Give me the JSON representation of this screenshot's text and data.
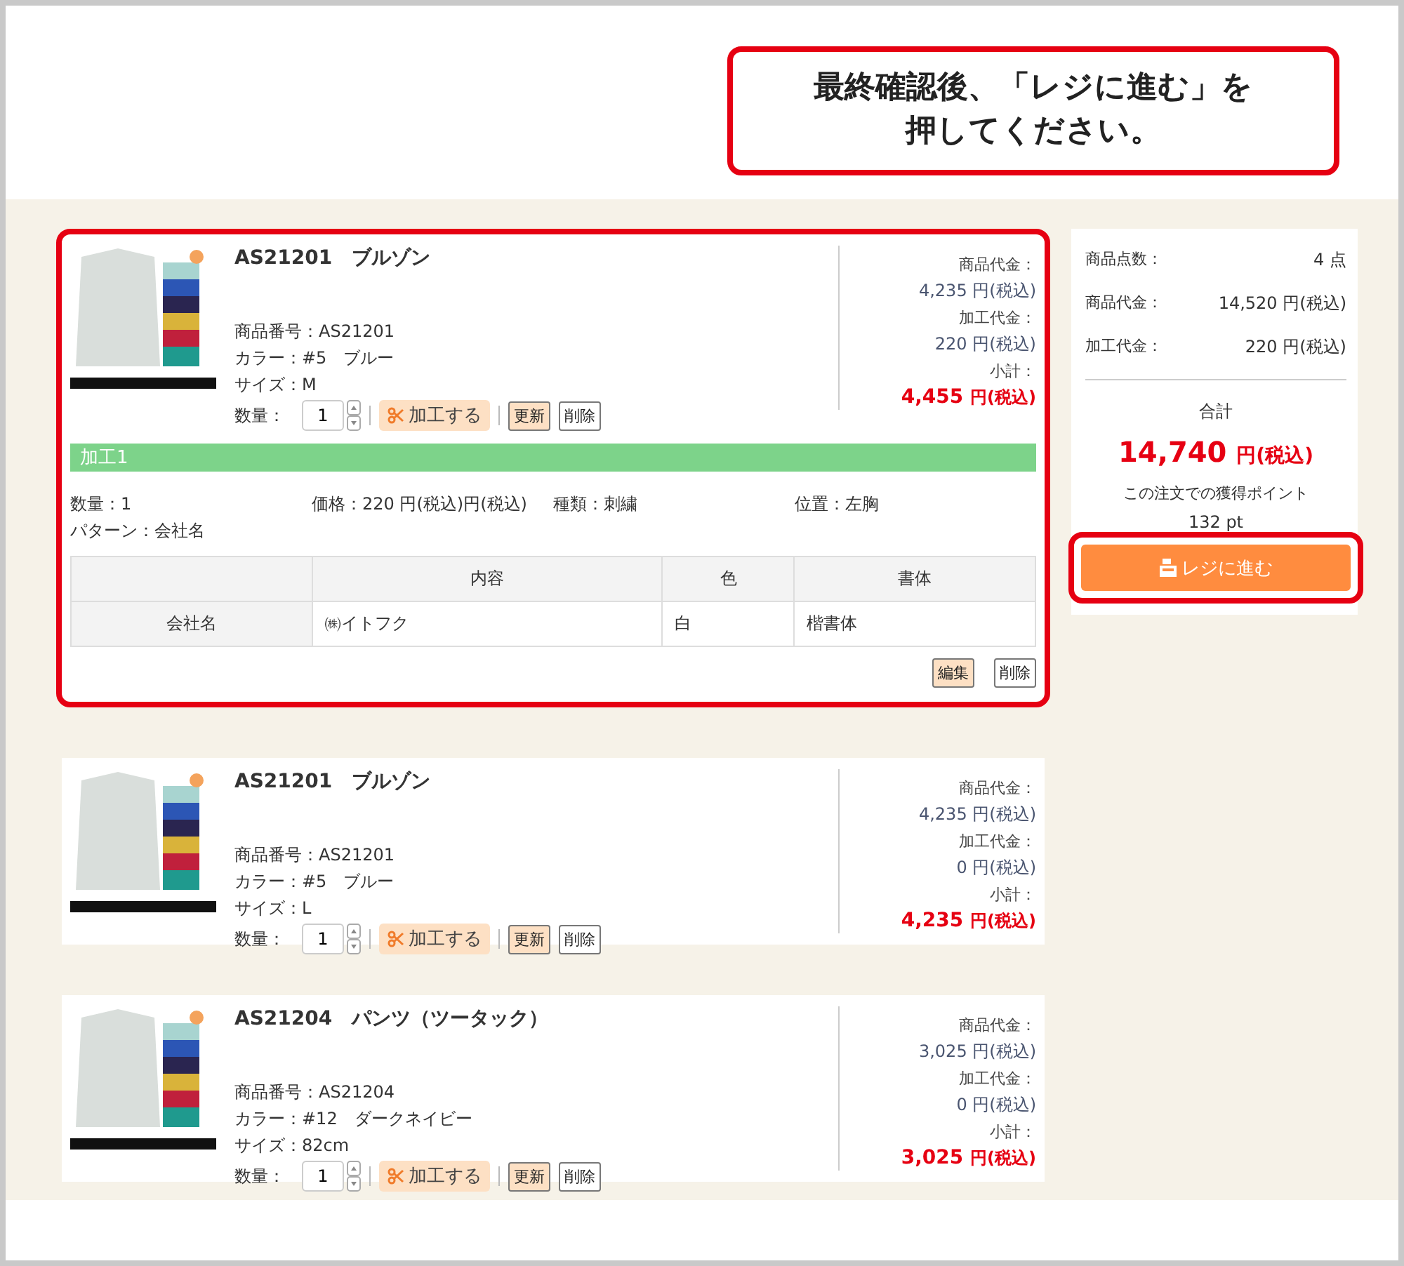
{
  "callout": {
    "text": "最終確認後、「レジに進む」を押してください。"
  },
  "items": [
    {
      "highlighted": true,
      "title": "AS21201　ブルゾン",
      "code": "商品番号：AS21201",
      "color_line": "カラー：#5　ブルー",
      "size": "サイズ：M",
      "quantity_label": "数量：",
      "quantity": "1",
      "process_button": "加工する",
      "update_button": "更新",
      "delete_button": "削除",
      "price_label": "商品代金：",
      "price": "4,235 円(税込)",
      "processing_label": "加工代金：",
      "processing": "220 円(税込)",
      "subtotal_label": "小計：",
      "subtotal": "4,455",
      "subtotal_unit": "円(税込)",
      "processes": [
        {
          "heading": "加工1",
          "quantity": "数量：1",
          "price": "価格：220 円(税込)円(税込)",
          "type": "種類：刺繍",
          "position": "位置：左胸",
          "pattern": "パターン：会社名",
          "table": {
            "columns": [
              "内容",
              "色",
              "書体"
            ],
            "rows": [
              {
                "label": "会社名",
                "cells": [
                  "㈱イトフク",
                  "白",
                  "楷書体"
                ]
              }
            ]
          },
          "edit_button": "編集",
          "delete_button": "削除"
        }
      ]
    },
    {
      "highlighted": false,
      "title": "AS21201　ブルゾン",
      "code": "商品番号：AS21201",
      "color_line": "カラー：#5　ブルー",
      "size": "サイズ：L",
      "quantity_label": "数量：",
      "quantity": "1",
      "process_button": "加工する",
      "update_button": "更新",
      "delete_button": "削除",
      "price_label": "商品代金：",
      "price": "4,235 円(税込)",
      "processing_label": "加工代金：",
      "processing": "0 円(税込)",
      "subtotal_label": "小計：",
      "subtotal": "4,235",
      "subtotal_unit": "円(税込)"
    },
    {
      "highlighted": false,
      "title": "AS21204　パンツ（ツータック）",
      "code": "商品番号：AS21204",
      "color_line": "カラー：#12　ダークネイビー",
      "size": "サイズ：82cm",
      "quantity_label": "数量：",
      "quantity": "1",
      "process_button": "加工する",
      "update_button": "更新",
      "delete_button": "削除",
      "price_label": "商品代金：",
      "price": "3,025 円(税込)",
      "processing_label": "加工代金：",
      "processing": "0 円(税込)",
      "subtotal_label": "小計：",
      "subtotal": "3,025",
      "subtotal_unit": "円(税込)"
    }
  ],
  "summary": {
    "rows": [
      {
        "label": "商品点数：",
        "value": "4 点"
      },
      {
        "label": "商品代金：",
        "value": "14,520 円(税込)"
      },
      {
        "label": "加工代金：",
        "value": "220 円(税込)"
      }
    ],
    "total_label": "合計",
    "total": "14,740",
    "total_unit": "円(税込)",
    "points_label": "この注文での獲得ポイント",
    "points": "132 pt",
    "checkout": {
      "label": "レジに進む",
      "highlighted": true
    }
  }
}
